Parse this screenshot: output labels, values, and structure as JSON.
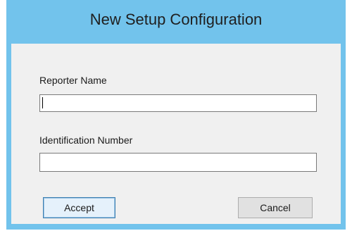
{
  "dialog": {
    "title": "New Setup Configuration",
    "fields": {
      "reporter_name": {
        "label": "Reporter Name",
        "value": ""
      },
      "identification_number": {
        "label": "Identification Number",
        "value": ""
      }
    },
    "buttons": {
      "accept_label": "Accept",
      "cancel_label": "Cancel"
    }
  },
  "colors": {
    "frame": "#72c3ec",
    "client_background": "#f0f0f0",
    "accept_button_border": "#3c7fb1"
  }
}
